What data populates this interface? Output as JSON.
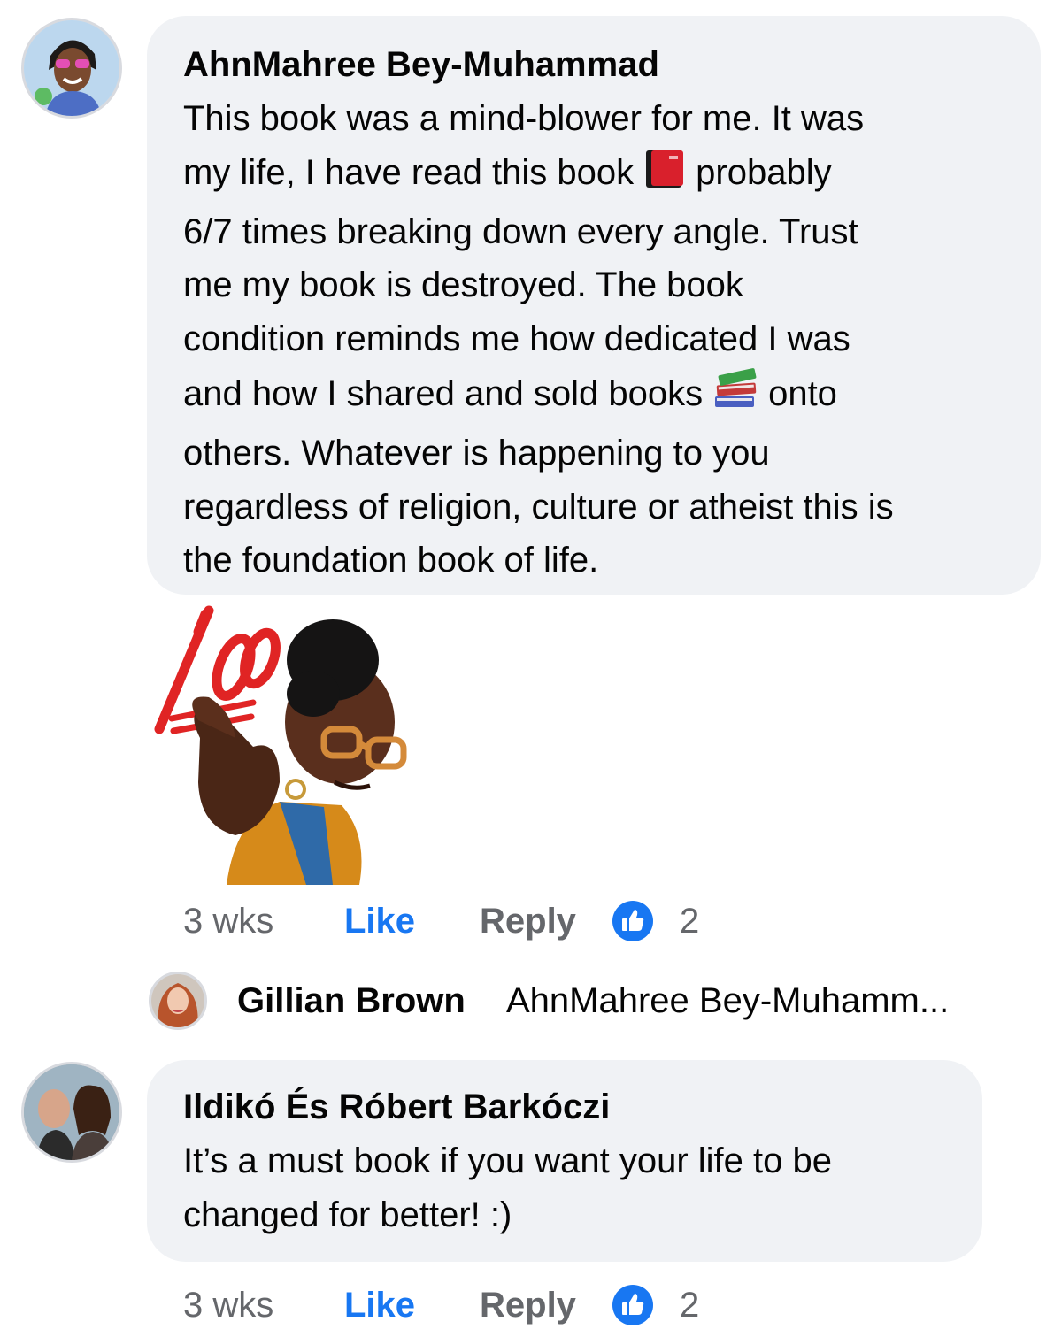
{
  "comments": [
    {
      "author": "AhnMahree Bey-Muhammad",
      "lines": [
        "This book was a mind-blower for me. It was",
        "my life, I have read this book",
        "probably",
        "6/7 times breaking down every angle. Trust",
        "me my book is destroyed. The book",
        "condition reminds me how dedicated I was",
        "and how I shared and sold books",
        "onto",
        "others. Whatever is happening to you",
        "regardless of religion, culture or atheist this is",
        "the foundation book of life."
      ],
      "inline_emoji": [
        "closed-book-emoji",
        "books-emoji"
      ],
      "sticker": "hundred-points-avatar-sticker",
      "time": "3 wks",
      "like_label": "Like",
      "reply_label": "Reply",
      "reaction_count": "2"
    },
    {
      "author": "Ildikó És Róbert Barkóczi",
      "lines": [
        "It’s a must book if you want your life to be",
        "changed for better! :)"
      ],
      "time": "3 wks",
      "like_label": "Like",
      "reply_label": "Reply",
      "reaction_count": "2"
    }
  ],
  "reply_preview": {
    "author": "Gillian Brown",
    "text": "AhnMahree Bey-Muhamm..."
  },
  "colors": {
    "bubble": "#f0f2f5",
    "like_blue": "#1877f2",
    "meta_gray": "#65676b"
  }
}
